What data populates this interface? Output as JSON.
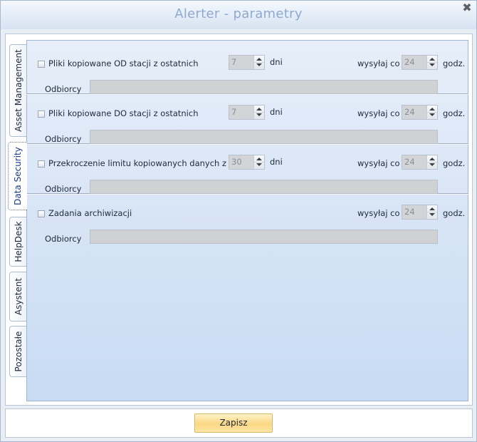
{
  "window": {
    "title": "Alerter - parametry"
  },
  "tabs": [
    {
      "label": "Asset Management",
      "active": false
    },
    {
      "label": "Data Security",
      "active": true
    },
    {
      "label": "HelpDesk",
      "active": false
    },
    {
      "label": "Asystent",
      "active": false
    },
    {
      "label": "Pozostałe",
      "active": false
    }
  ],
  "sections": [
    {
      "checkbox_label": "Pliki kopiowane OD stacji z ostatnich",
      "days_value": "7",
      "days_unit": "dni",
      "send_label": "wysyłaj co",
      "hours_value": "24",
      "hours_unit": "godz.",
      "recipients_label": "Odbiorcy",
      "recipients_value": ""
    },
    {
      "checkbox_label": "Pliki kopiowane DO stacji z ostatnich",
      "days_value": "7",
      "days_unit": "dni",
      "send_label": "wysyłaj co",
      "hours_value": "24",
      "hours_unit": "godz.",
      "recipients_label": "Odbiorcy",
      "recipients_value": ""
    },
    {
      "checkbox_label": "Przekroczenie limitu kopiowanych danych z",
      "days_value": "30",
      "days_unit": "dni",
      "send_label": "wysyłaj co",
      "hours_value": "24",
      "hours_unit": "godz.",
      "recipients_label": "Odbiorcy",
      "recipients_value": ""
    },
    {
      "checkbox_label": "Zadania archiwizacji",
      "send_label": "wysyłaj co",
      "hours_value": "24",
      "hours_unit": "godz.",
      "recipients_label": "Odbiorcy",
      "recipients_value": ""
    }
  ],
  "footer": {
    "save_label": "Zapisz"
  },
  "icons": {
    "close": "close-icon"
  }
}
